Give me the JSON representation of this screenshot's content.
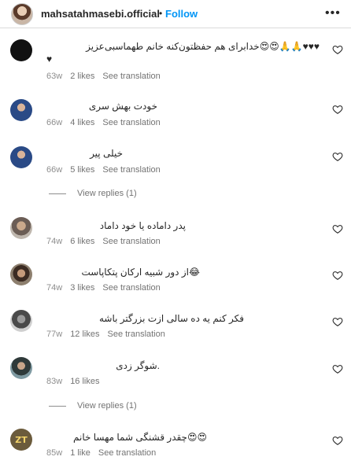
{
  "header": {
    "username": "mahsatahmasebi.official",
    "dot": "•",
    "follow_label": "Follow",
    "more_icon": "•••"
  },
  "comments": [
    {
      "text": "♥♥♥🙏🙏😍😍خدابرای هم حفظتون‌کنه خانم طهماسبی‌عزیز",
      "text2": "♥",
      "time": "63w",
      "likes": "2 likes",
      "translate": "See translation",
      "avatar": "black"
    },
    {
      "text": "خودت بهش سری",
      "time": "66w",
      "likes": "4 likes",
      "translate": "See translation",
      "avatar": "blue"
    },
    {
      "text": "خیلی پیر",
      "time": "66w",
      "likes": "5 likes",
      "translate": "See translation",
      "avatar": "blue",
      "replies": "View replies (1)"
    },
    {
      "text": "پدر داماده یا خود داماد",
      "time": "74w",
      "likes": "6 likes",
      "translate": "See translation",
      "avatar": "bw"
    },
    {
      "text": "😂از دور شبیه ارکان پتکاپاست",
      "time": "74w",
      "likes": "3 likes",
      "translate": "See translation",
      "avatar": "beard"
    },
    {
      "text": "فکر کنم یه ده سالی ازت بزرگتر باشه",
      "time": "77w",
      "likes": "12 likes",
      "translate": "See translation",
      "avatar": "gray"
    },
    {
      "text": ".شوگر زدی",
      "time": "83w",
      "likes": "16 likes",
      "translate": "",
      "avatar": "teal",
      "replies": "View replies (1)"
    },
    {
      "text": "😍😍چقدر قشنگی شما مهسا خانم",
      "time": "85w",
      "likes": "1 like",
      "translate": "See translation",
      "avatar": "zt",
      "avatar_text": "ZT"
    }
  ],
  "icons": {
    "heart": "heart-outline-icon"
  },
  "colors": {
    "accent": "#0095f6",
    "meta": "#8e8e8e"
  }
}
